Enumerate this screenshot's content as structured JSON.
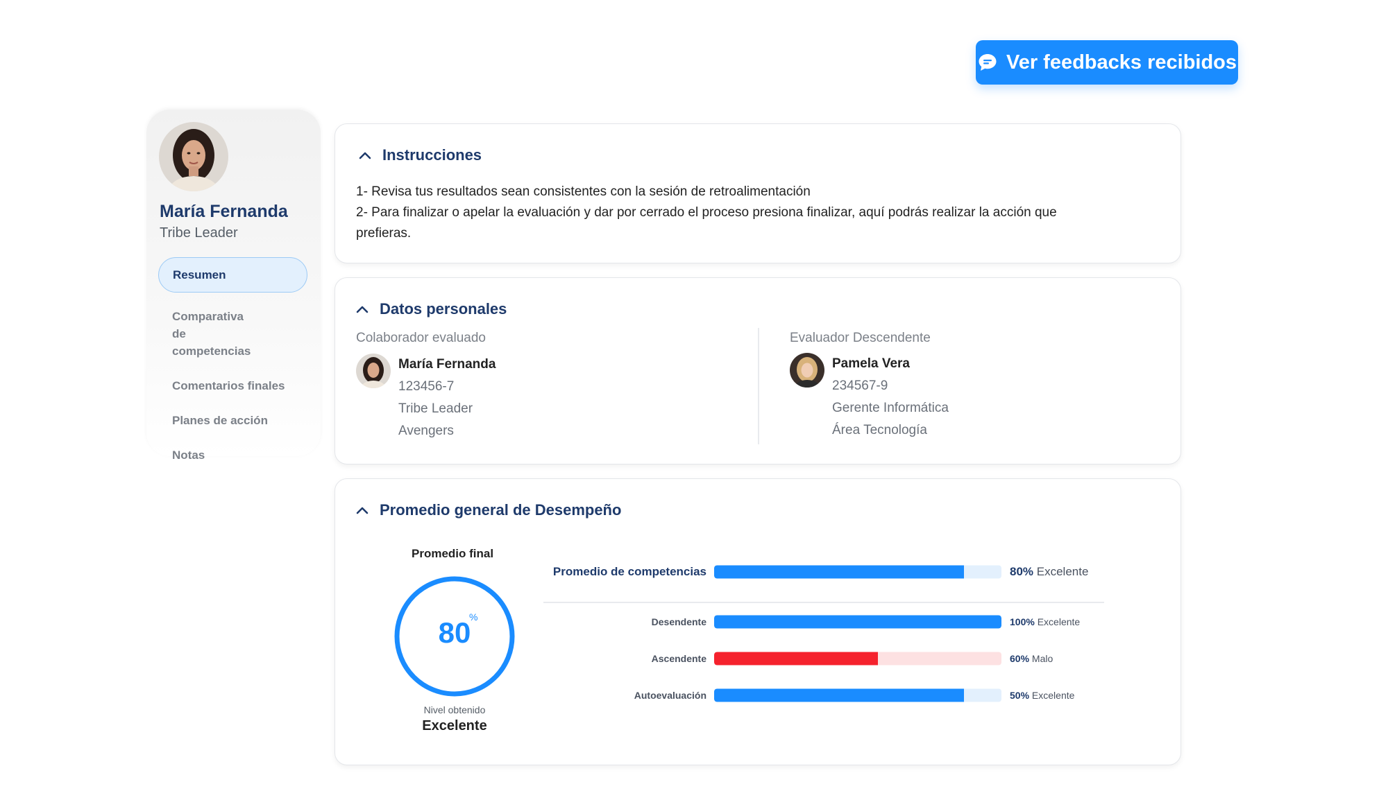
{
  "header": {
    "feedback_button_label": "Ver feedbacks recibidos",
    "feedback_icon": "chat-bubble-icon",
    "accent_color": "#1a8cff"
  },
  "sidebar": {
    "user_name": "María Fernanda",
    "user_role": "Tribe Leader",
    "items": [
      {
        "label": "Resumen",
        "active": true
      },
      {
        "label": "Comparativa de competencias",
        "active": false
      },
      {
        "label": "Comentarios finales",
        "active": false
      },
      {
        "label": "Planes de acción",
        "active": false
      },
      {
        "label": "Notas",
        "active": false
      }
    ]
  },
  "instructions": {
    "title": "Instrucciones",
    "line1": "1- Revisa tus resultados sean consistentes con la sesión de retroalimentación",
    "line2": "2- Para finalizar o apelar la evaluación y dar por cerrado el proceso presiona finalizar, aquí podrás realizar la acción que prefieras."
  },
  "datos": {
    "title": "Datos personales",
    "colaborador": {
      "label": "Colaborador evaluado",
      "name": "María Fernanda",
      "id": "123456-7",
      "role": "Tribe Leader",
      "team": "Avengers"
    },
    "evaluador": {
      "label": "Evaluador Descendente",
      "name": "Pamela Vera",
      "id": "234567-9",
      "role": "Gerente Informática",
      "area": "Área Tecnología"
    }
  },
  "promedio": {
    "title": "Promedio general de Desempeño",
    "final_label": "Promedio final",
    "final_value": "80",
    "final_unit": "%",
    "final_fraction": 0.8,
    "nivel_label": "Nivel obtenido",
    "nivel_value": "Excelente",
    "bars": [
      {
        "label": "Promedio de competencias",
        "pct": "80%",
        "rating": "Excelente",
        "fill": 0.87,
        "color": "#1a8cff",
        "track": "#e3f0fd",
        "main": true
      },
      {
        "label": "Desendente",
        "pct": "100%",
        "rating": "Excelente",
        "fill": 1.0,
        "color": "#1a8cff",
        "track": "#e3f0fd",
        "main": false
      },
      {
        "label": "Ascendente",
        "pct": "60%",
        "rating": "Malo",
        "fill": 0.57,
        "color": "#f5222d",
        "track": "#fde1e2",
        "main": false
      },
      {
        "label": "Autoevaluación",
        "pct": "50%",
        "rating": "Excelente",
        "fill": 0.87,
        "color": "#1a8cff",
        "track": "#e3f0fd",
        "main": false
      }
    ]
  }
}
